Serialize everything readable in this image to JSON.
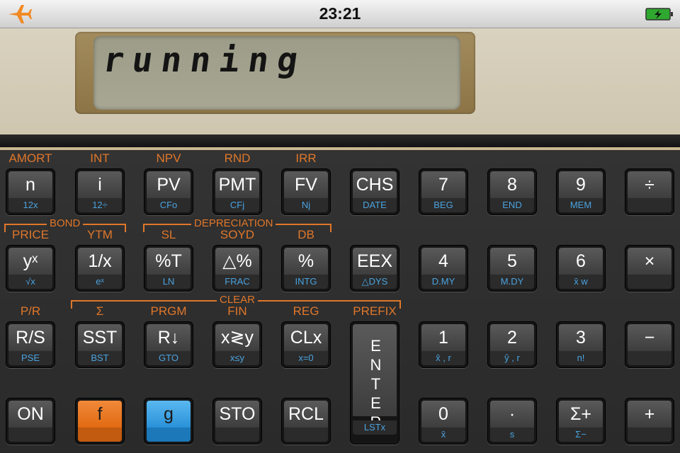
{
  "status": {
    "time": "23:21"
  },
  "display": {
    "text": "running"
  },
  "rows": [
    [
      {
        "id": "n",
        "f": "AMORT",
        "main": "n",
        "g": "12x"
      },
      {
        "id": "i",
        "f": "INT",
        "main": "i",
        "g": "12÷"
      },
      {
        "id": "pv",
        "f": "NPV",
        "main": "PV",
        "g": "CFo"
      },
      {
        "id": "pmt",
        "f": "RND",
        "main": "PMT",
        "g": "CFj"
      },
      {
        "id": "fv",
        "f": "IRR",
        "main": "FV",
        "g": "Nj"
      },
      {
        "id": "chs",
        "f": "",
        "main": "CHS",
        "g": "DATE"
      },
      {
        "id": "7",
        "f": "",
        "main": "7",
        "g": "BEG"
      },
      {
        "id": "8",
        "f": "",
        "main": "8",
        "g": "END"
      },
      {
        "id": "9",
        "f": "",
        "main": "9",
        "g": "MEM"
      },
      {
        "id": "divide",
        "f": "",
        "main": "÷",
        "g": ""
      }
    ],
    [
      {
        "id": "yx",
        "f": "PRICE",
        "main": "yˣ",
        "g": "√x"
      },
      {
        "id": "reciprocal",
        "f": "YTM",
        "main": "1/x",
        "g": "eˣ"
      },
      {
        "id": "percent-total",
        "f": "SL",
        "main": "%T",
        "g": "LN"
      },
      {
        "id": "delta-percent",
        "f": "SOYD",
        "main": "△%",
        "g": "FRAC"
      },
      {
        "id": "percent",
        "f": "DB",
        "main": "%",
        "g": "INTG"
      },
      {
        "id": "eex",
        "f": "",
        "main": "EEX",
        "g": "△DYS"
      },
      {
        "id": "4",
        "f": "",
        "main": "4",
        "g": "D.MY"
      },
      {
        "id": "5",
        "f": "",
        "main": "5",
        "g": "M.DY"
      },
      {
        "id": "6",
        "f": "",
        "main": "6",
        "g": "x̄ w"
      },
      {
        "id": "multiply",
        "f": "",
        "main": "×",
        "g": ""
      }
    ],
    [
      {
        "id": "rs",
        "f": "P/R",
        "main": "R/S",
        "g": "PSE"
      },
      {
        "id": "sst",
        "f": "Σ",
        "main": "SST",
        "g": "BST"
      },
      {
        "id": "rdown",
        "f": "PRGM",
        "main": "R↓",
        "g": "GTO"
      },
      {
        "id": "xy",
        "f": "FIN",
        "main": "x≷y",
        "g": "x≤y"
      },
      {
        "id": "clx",
        "f": "REG",
        "main": "CLx",
        "g": "x=0"
      },
      {
        "id": "enter",
        "f": "PREFIX",
        "main": "ENTER",
        "g": "LSTx"
      },
      {
        "id": "1",
        "f": "",
        "main": "1",
        "g": "x̂ , r"
      },
      {
        "id": "2",
        "f": "",
        "main": "2",
        "g": "ŷ , r"
      },
      {
        "id": "3",
        "f": "",
        "main": "3",
        "g": "n!"
      },
      {
        "id": "minus",
        "f": "",
        "main": "−",
        "g": ""
      }
    ],
    [
      {
        "id": "on",
        "f": "",
        "main": "ON",
        "g": ""
      },
      {
        "id": "f",
        "f": "",
        "main": "f",
        "g": ""
      },
      {
        "id": "g",
        "f": "",
        "main": "g",
        "g": ""
      },
      {
        "id": "sto",
        "f": "",
        "main": "STO",
        "g": ""
      },
      {
        "id": "rcl",
        "f": "",
        "main": "RCL",
        "g": ""
      },
      {
        "id": "0",
        "f": "",
        "main": "0",
        "g": "x̄"
      },
      {
        "id": "dot",
        "f": "",
        "main": "·",
        "g": "s"
      },
      {
        "id": "sigma-plus",
        "f": "",
        "main": "Σ+",
        "g": "Σ−"
      },
      {
        "id": "plus",
        "f": "",
        "main": "+",
        "g": ""
      }
    ]
  ],
  "groups": {
    "bond": "BOND",
    "depreciation": "DEPRECIATION",
    "clear": "CLEAR"
  },
  "colors": {
    "f_accent": "#e0772a",
    "g_accent": "#4aa3e0"
  }
}
